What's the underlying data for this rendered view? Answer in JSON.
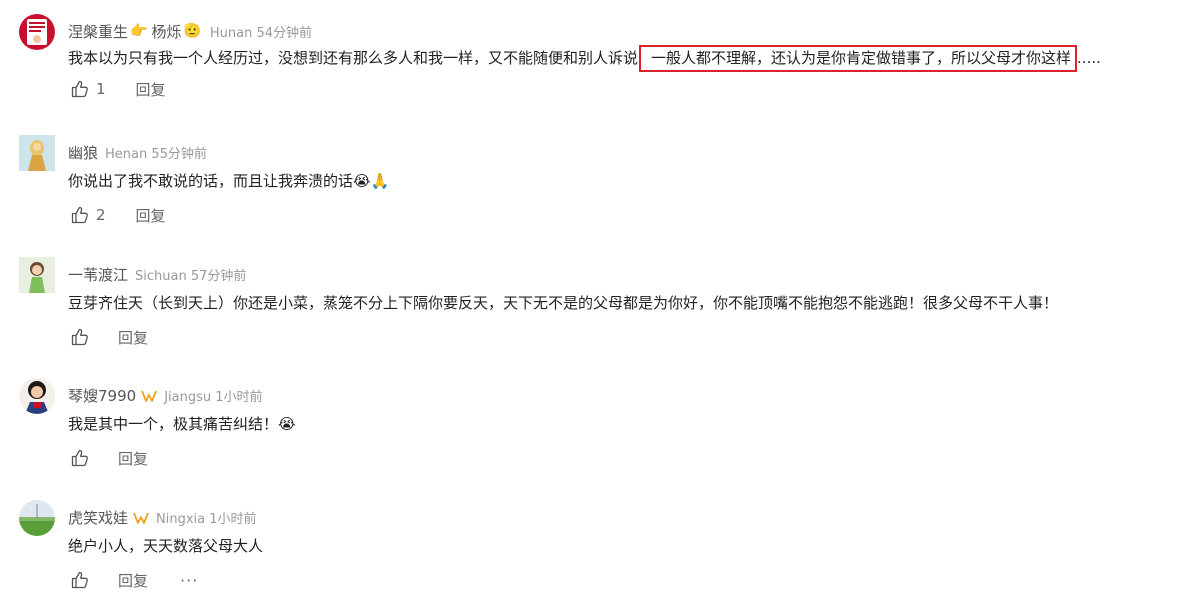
{
  "comments": [
    {
      "username": "涅槃重生",
      "emoji_after_name": "👉",
      "username2": "杨烁",
      "emoji_after_name2": "🫡",
      "location": "Hunan",
      "time": "54分钟前",
      "text_before": "我本以为只有我一个人经历过，没想到还有那么多人和我一样，又不能随便和别人诉说",
      "text_highlight": "一般人都不理解，还认为是你肯定做错事了，所以父母才你这样",
      "text_after": ".....",
      "likes": "1",
      "reply_label": "回复"
    },
    {
      "username": "幽狼",
      "location": "Henan",
      "time": "55分钟前",
      "text": "你说出了我不敢说的话，而且让我奔溃的话😭🙏",
      "likes": "2",
      "reply_label": "回复"
    },
    {
      "username": "一苇渡江",
      "location": "Sichuan",
      "time": "57分钟前",
      "text": "豆芽齐住天（长到天上）你还是小菜，蒸笼不分上下隔你要反天，天下无不是的父母都是为你好，你不能顶嘴不能抱怨不能逃跑！很多父母不干人事！",
      "likes": "",
      "reply_label": "回复"
    },
    {
      "username": "琴嫂7990",
      "location": "Jiangsu",
      "time": "1小时前",
      "text": "我是其中一个，极其痛苦纠结！😭",
      "likes": "",
      "reply_label": "回复"
    },
    {
      "username": "虎笑戏娃",
      "location": "Ningxia",
      "time": "1小时前",
      "text": "绝户小人，天天数落父母大人",
      "likes": "",
      "reply_label": "回复",
      "more_label": "···"
    }
  ],
  "colors": {
    "highlight_border": "#d9232d",
    "badge": "#f0a020",
    "meta_text": "#999999"
  }
}
